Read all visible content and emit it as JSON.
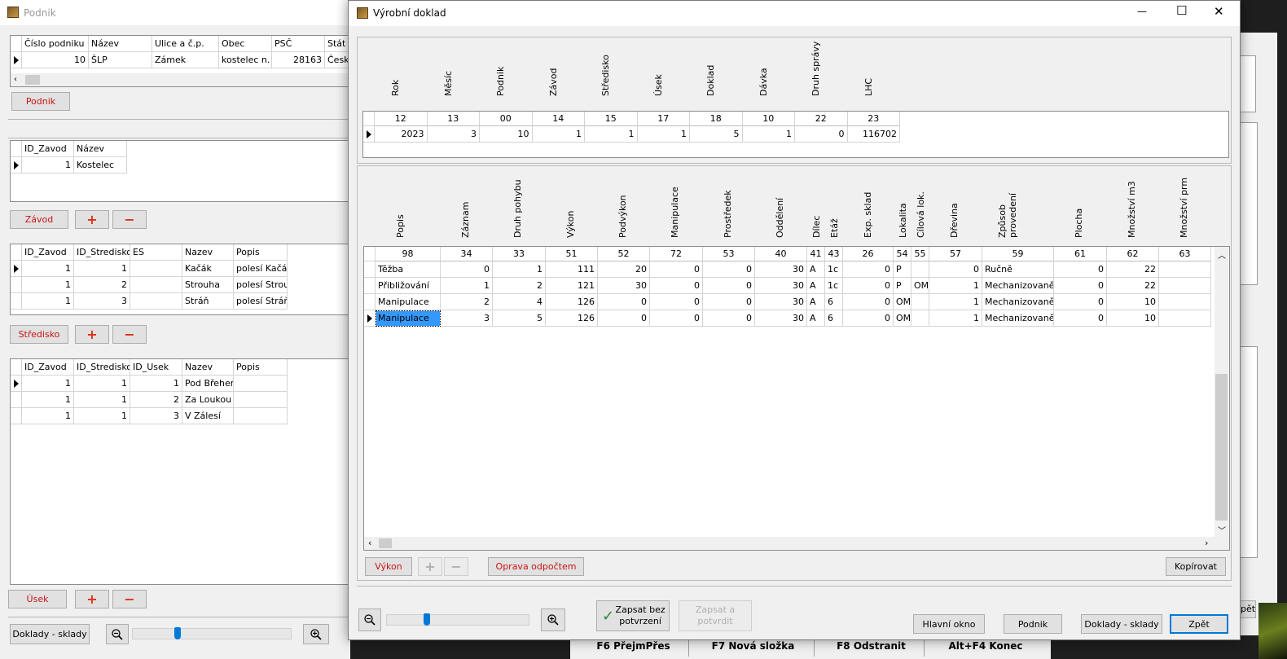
{
  "bg_window": {
    "title": "Podnik",
    "podnik_grid": {
      "headers": [
        "Číslo podniku",
        "Název",
        "Ulice a č.p.",
        "Obec",
        "PSČ",
        "Stát"
      ],
      "rows": [
        [
          "10",
          "ŠLP",
          "Zámek",
          "kostelec n. Č",
          "28163",
          "Česká"
        ]
      ]
    },
    "podnik_button": "Podnik",
    "zavod_grid": {
      "headers": [
        "ID_Zavod",
        "Název"
      ],
      "rows": [
        [
          "1",
          "Kostelec"
        ]
      ]
    },
    "zavod_button": "Závod",
    "stredisko_grid": {
      "headers": [
        "ID_Zavod",
        "ID_Stredisko",
        "ES",
        "Nazev",
        "Popis"
      ],
      "rows": [
        [
          "1",
          "1",
          "",
          "Kačák",
          "polesí Kačák"
        ],
        [
          "1",
          "2",
          "",
          "Strouha",
          "polesí Strouha"
        ],
        [
          "1",
          "3",
          "",
          "Stráň",
          "polesí Stráň"
        ]
      ]
    },
    "stredisko_button": "Středisko",
    "usek_grid": {
      "headers": [
        "ID_Zavod",
        "ID_Stredisko",
        "ID_Usek",
        "Nazev",
        "Popis"
      ],
      "rows": [
        [
          "1",
          "1",
          "1",
          "Pod Břehem",
          ""
        ],
        [
          "1",
          "1",
          "2",
          "Za Loukou",
          ""
        ],
        [
          "1",
          "1",
          "3",
          "V Zálesí",
          ""
        ]
      ]
    },
    "usek_button": "Úsek",
    "doklady_button": "Doklady - sklady",
    "plus": "+",
    "minus": "−"
  },
  "taskbar": {
    "items": [
      "F6 PřejmPřes",
      "F7 Nová složka",
      "F8 Odstranit",
      "Alt+F4 Konec"
    ]
  },
  "right_peek": {
    "button_fragment": "pět"
  },
  "dialog": {
    "title": "Výrobní doklad",
    "controls": {
      "minimize": "—",
      "maximize": "☐",
      "close": "✕"
    },
    "header_grid": {
      "columns": [
        "Rok",
        "Měsíc",
        "Podnik",
        "Závod",
        "Středisko",
        "Úsek",
        "Doklad",
        "Dávka",
        "Druh správy",
        "LHC"
      ],
      "codes": [
        "12",
        "13",
        "00",
        "14",
        "15",
        "17",
        "18",
        "10",
        "22",
        "23"
      ],
      "row": [
        "2023",
        "3",
        "10",
        "1",
        "1",
        "1",
        "5",
        "1",
        "0",
        "116702"
      ]
    },
    "detail_grid": {
      "columns": [
        "Popis",
        "Záznam",
        "Druh pohybu",
        "Výkon",
        "Podvýkon",
        "Manipulace",
        "Prostředek",
        "Oddělení",
        "Dílec",
        "Etáž",
        "Exp. sklad",
        "Lokalita",
        "Cílová lok.",
        "Dřevina",
        "Způsob provedení",
        "Plocha",
        "Množství m3",
        "Množství prm"
      ],
      "codes": [
        "98",
        "34",
        "33",
        "51",
        "52",
        "72",
        "53",
        "40",
        "41",
        "43",
        "26",
        "54",
        "55",
        "57",
        "59",
        "61",
        "62",
        "63"
      ],
      "rows": [
        [
          "Těžba",
          "0",
          "1",
          "111",
          "20",
          "0",
          "0",
          "30",
          "A",
          "1c",
          "0",
          "P",
          "",
          "0",
          "Ručně",
          "0",
          "22",
          ""
        ],
        [
          "Přibližování",
          "1",
          "2",
          "121",
          "30",
          "0",
          "0",
          "30",
          "A",
          "1c",
          "0",
          "P",
          "OM",
          "1",
          "Mechanizovaně",
          "0",
          "22",
          ""
        ],
        [
          "Manipulace",
          "2",
          "4",
          "126",
          "0",
          "0",
          "0",
          "30",
          "A",
          "6",
          "0",
          "OM",
          "",
          "1",
          "Mechanizovaně",
          "0",
          "10",
          ""
        ],
        [
          "Manipulace",
          "3",
          "5",
          "126",
          "0",
          "0",
          "0",
          "30",
          "A",
          "6",
          "0",
          "OM",
          "",
          "1",
          "Mechanizovaně",
          "0",
          "10",
          ""
        ]
      ]
    },
    "buttons": {
      "vykon": "Výkon",
      "plus": "+",
      "minus": "−",
      "oprava": "Oprava odpočtem",
      "kopirovat": "Kopírovat",
      "zapsat_bez": "Zapsat bez potvrzení",
      "zapsat_a": "Zapsat a potvrdit",
      "hlavni_okno": "Hlavní okno",
      "podnik": "Podnik",
      "doklady": "Doklady - sklady",
      "zpet": "Zpět"
    },
    "zapsat_bez_checked": true
  },
  "colors": {
    "accent": "#0078d7",
    "red_label": "#c81414",
    "selection": "#3399ff"
  }
}
